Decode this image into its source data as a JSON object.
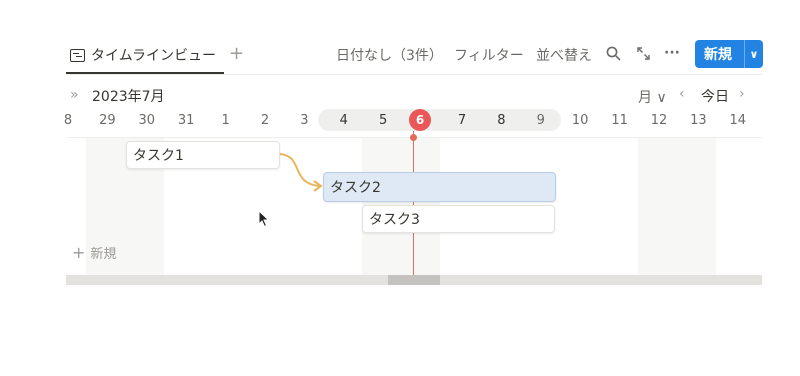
{
  "view_tab": {
    "icon": "timeline-icon",
    "label": "タイムラインビュー"
  },
  "add_view": "+",
  "toolbar": {
    "no_date": "日付なし（3件）",
    "filter": "フィルター",
    "sort": "並べ替え",
    "search_icon": "search-icon",
    "expand_icon": "expand-icon",
    "more": "···",
    "new_label": "新規",
    "new_chevron": "∨"
  },
  "calendar": {
    "collapse": "»",
    "month": "2023年7月",
    "scale": "月 ∨",
    "prev": "‹",
    "today": "今日",
    "next": "›",
    "today_date": "6",
    "days": [
      "8",
      "29",
      "30",
      "31",
      "1",
      "2",
      "3",
      "4",
      "5",
      "6",
      "7",
      "8",
      "9",
      "10",
      "11",
      "12",
      "13",
      "14"
    ]
  },
  "tasks": [
    {
      "name": "タスク1"
    },
    {
      "name": "タスク2"
    },
    {
      "name": "タスク3"
    }
  ],
  "add_row": {
    "plus": "+",
    "label": "新規"
  },
  "colors": {
    "accent": "#2383e2",
    "today": "#eb5757",
    "dependency": "#e8b45c",
    "selected_task": "#dfe9f5"
  }
}
